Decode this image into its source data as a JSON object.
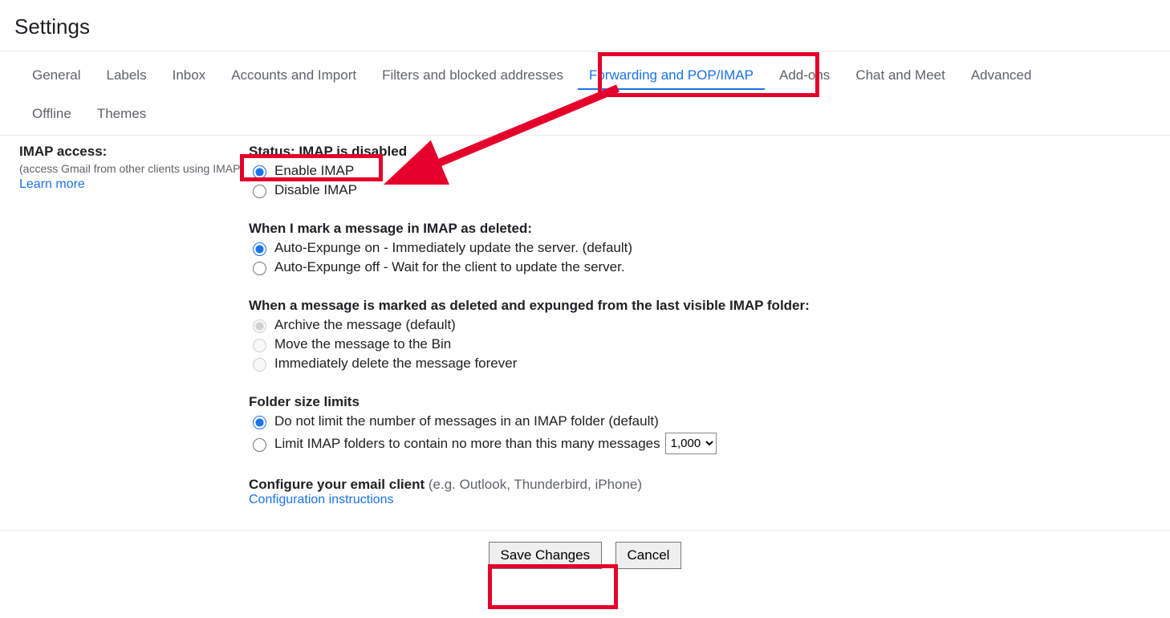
{
  "page_title": "Settings",
  "tabs_row1": [
    {
      "label": "General",
      "active": false
    },
    {
      "label": "Labels",
      "active": false
    },
    {
      "label": "Inbox",
      "active": false
    },
    {
      "label": "Accounts and Import",
      "active": false
    },
    {
      "label": "Filters and blocked addresses",
      "active": false
    },
    {
      "label": "Forwarding and POP/IMAP",
      "active": true
    },
    {
      "label": "Add-ons",
      "active": false
    },
    {
      "label": "Chat and Meet",
      "active": false
    },
    {
      "label": "Advanced",
      "active": false
    }
  ],
  "tabs_row2": [
    {
      "label": "Offline",
      "active": false
    },
    {
      "label": "Themes",
      "active": false
    }
  ],
  "imap_access": {
    "title": "IMAP access:",
    "subtext": "(access Gmail from other clients using IMAP)",
    "learn_more": "Learn more"
  },
  "status": {
    "heading": "Status: IMAP is disabled",
    "enable_label": "Enable IMAP",
    "disable_label": "Disable IMAP"
  },
  "deleted": {
    "heading": "When I mark a message in IMAP as deleted:",
    "opt1": "Auto-Expunge on - Immediately update the server. (default)",
    "opt2": "Auto-Expunge off - Wait for the client to update the server."
  },
  "expunged": {
    "heading": "When a message is marked as deleted and expunged from the last visible IMAP folder:",
    "opt1": "Archive the message (default)",
    "opt2": "Move the message to the Bin",
    "opt3": "Immediately delete the message forever"
  },
  "folder": {
    "heading": "Folder size limits",
    "opt1": "Do not limit the number of messages in an IMAP folder (default)",
    "opt2": "Limit IMAP folders to contain no more than this many messages",
    "select_value": "1,000"
  },
  "configure": {
    "bold": "Configure your email client",
    "muted": " (e.g. Outlook, Thunderbird, iPhone)",
    "link": "Configuration instructions"
  },
  "footer": {
    "save": "Save Changes",
    "cancel": "Cancel"
  }
}
